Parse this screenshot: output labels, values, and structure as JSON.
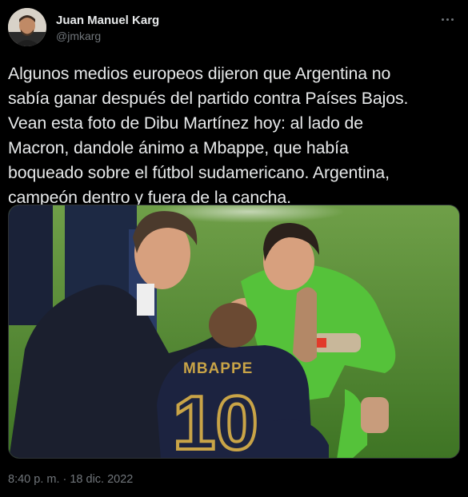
{
  "author": {
    "display_name": "Juan Manuel Karg",
    "handle": "@jmkarg",
    "avatar_icon": "profile-photo"
  },
  "tweet": {
    "text": "Algunos medios europeos dijeron que Argentina no\nsabía ganar después del partido contra Países Bajos.\nVean esta foto de Dibu Martínez hoy: al lado de\nMacron, dandole ánimo a Mbappe, que había\nboqueado sobre el fútbol sudamericano. Argentina,\ncampeón dentro y fuera de la cancha.",
    "timestamp": "8:40 p. m. · 18 dic. 2022"
  },
  "photo": {
    "jersey_name": "MBAPPE",
    "jersey_number": "10"
  },
  "colors": {
    "background": "#000000",
    "text_primary": "#e7e9ea",
    "text_secondary": "#71767b",
    "pitch_green": "#4f8a2f",
    "keeper_green": "#55c23a",
    "france_navy": "#1c2340",
    "gold": "#c9a447"
  }
}
